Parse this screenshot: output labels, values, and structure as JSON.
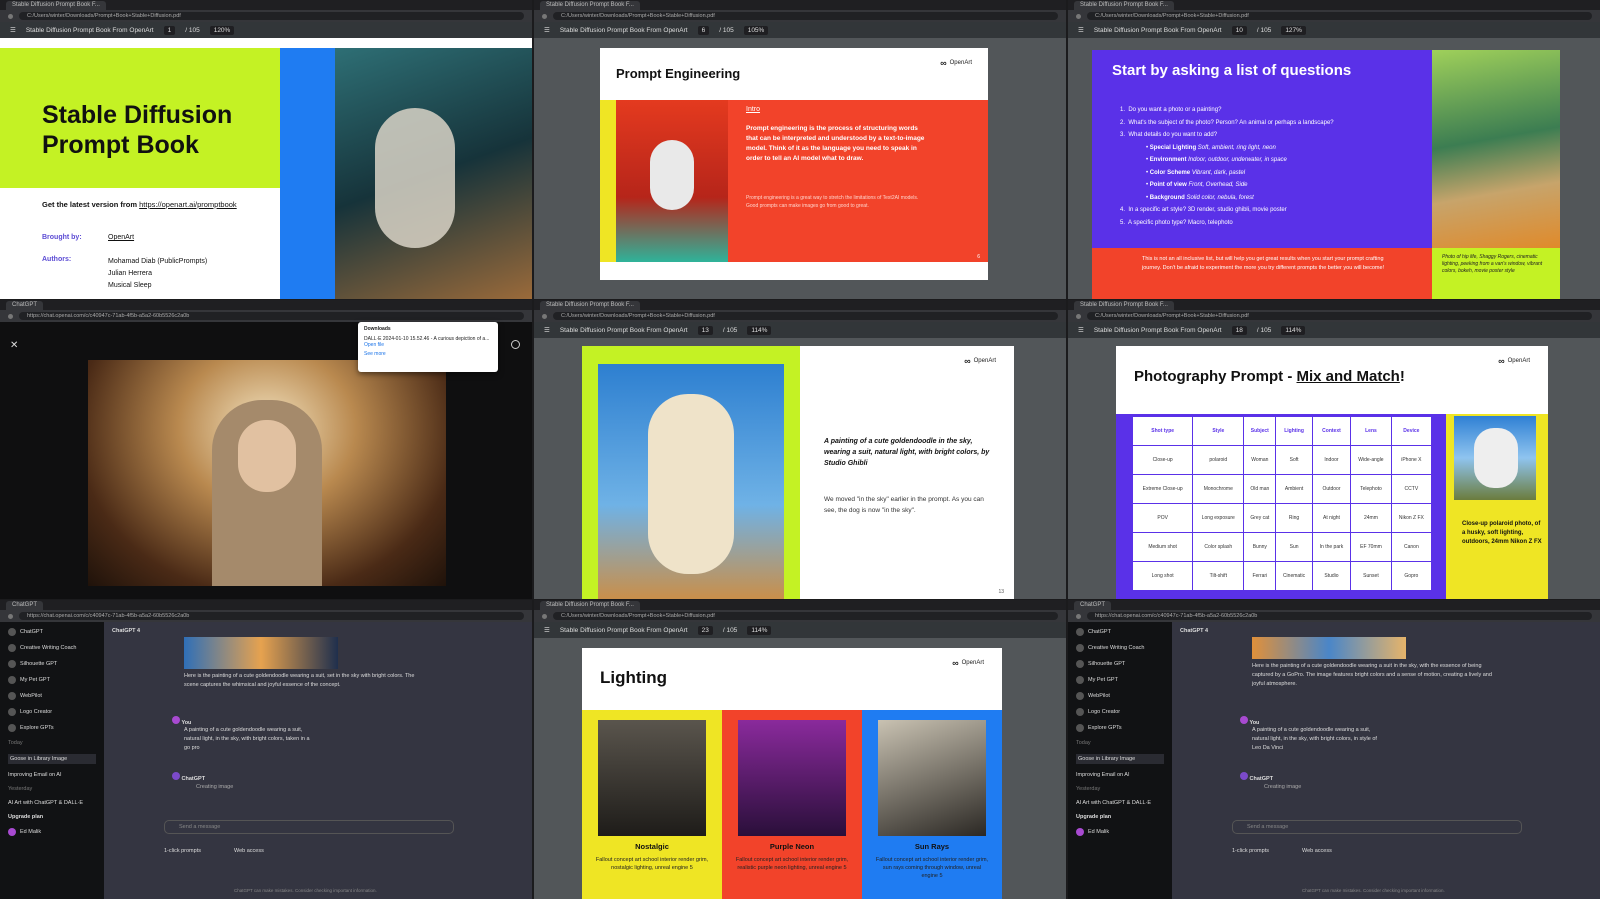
{
  "browser": {
    "pdf_tab": "Stable Diffusion Prompt Book F...",
    "chat_tab": "ChatGPT",
    "pdf_url": "C:/Users/winter/Downloads/Prompt+Book+Stable+Diffusion.pdf",
    "chat_url": "https://chat.openai.com/c/c40947c-71ab-4f5b-a5a2-60b5526c2a0b",
    "pdf_title": "Stable Diffusion Prompt Book From OpenArt"
  },
  "panel1": {
    "page": "1",
    "total": "/ 105",
    "zoom": "120%",
    "title": "Stable Diffusion Prompt Book",
    "latest_label": "Get the latest version from",
    "latest_link": "https://openart.ai/promptbook",
    "brought_label": "Brought by:",
    "brought_value": "OpenArt",
    "authors_label": "Authors:",
    "author1": "Mohamad Diab (PublicPrompts)",
    "author2": "Julian Herrera",
    "author3": "Musical Sleep"
  },
  "panel2": {
    "page": "6",
    "total": "/ 105",
    "zoom": "105%",
    "title": "Prompt Engineering",
    "logo": "OpenArt",
    "intro": "Intro",
    "body": "Prompt engineering is the process of structuring words that can be interpreted and understood by a text-to-image model. Think of it as the language you need to speak in order to tell an AI model what to draw.",
    "small": "Prompt engineering is a great way to stretch the limitations of Text2AI models. Good prompts can make images go from good to great.",
    "pagenum": "6"
  },
  "panel3": {
    "page": "10",
    "total": "/ 105",
    "zoom": "127%",
    "title": "Start by asking a list of questions",
    "q1": "Do you want a photo or a painting?",
    "q2": "What's the subject of the photo? Person? An animal or perhaps a landscape?",
    "q3": "What details do you want to add?",
    "details": [
      {
        "k": "Special Lighting",
        "v": "Soft, ambient, ring light, neon"
      },
      {
        "k": "Environment",
        "v": "Indoor, outdoor, underwater, in space"
      },
      {
        "k": "Color Scheme",
        "v": "Vibrant, dark, pastel"
      },
      {
        "k": "Point of view",
        "v": "Front, Overhead, Side"
      },
      {
        "k": "Background",
        "v": "Solid color, nebula, forest"
      }
    ],
    "q4": "In a specific art style? 3D render, studio ghibli, movie poster",
    "q5": "A specific photo type? Macro, telephoto",
    "footer": "This is not an all inclusive list, but will help you get great results when you start your prompt crafting journey. Don't be afraid to experiment the more you try different prompts the better you will become!",
    "caption": "Photo of hip life, Shaggy Rogers, cinematic lighting, peeking from a van's window, vibrant colors, bokeh, movie poster style"
  },
  "panel4": {
    "downloads_title": "Downloads",
    "file": "DALL·E 2024-01-10 15.52.46 - A curious depiction of a...",
    "open_file": "Open file",
    "see_more": "See more"
  },
  "panel5": {
    "page": "13",
    "total": "/ 105",
    "zoom": "114%",
    "logo": "OpenArt",
    "prompt": "A painting of a cute goldendoodle in the sky, wearing a suit, natural light, with bright colors, by Studio Ghibli",
    "note": "We moved \"in the sky\" earlier in the prompt. As you can see, the dog is now \"in the sky\".",
    "pagenum": "13"
  },
  "panel6": {
    "page": "18",
    "total": "/ 105",
    "zoom": "114%",
    "logo": "OpenArt",
    "title_a": "Photography Prompt - ",
    "title_b": "Mix and Match",
    "title_c": "!",
    "headers": [
      "Shot type",
      "Style",
      "Subject",
      "Lighting",
      "Context",
      "Lens",
      "Device"
    ],
    "rows": [
      [
        "Close-up",
        "polaroid",
        "Woman",
        "Soft",
        "Indoor",
        "Wide-angle",
        "iPhone X"
      ],
      [
        "Extreme Close-up",
        "Monochrome",
        "Old man",
        "Ambient",
        "Outdoor",
        "Telephoto",
        "CCTV"
      ],
      [
        "POV",
        "Long exposure",
        "Grey cat",
        "Ring",
        "At night",
        "24mm",
        "Nikon Z FX"
      ],
      [
        "Medium shot",
        "Color splash",
        "Bunny",
        "Sun",
        "In the park",
        "EF 70mm",
        "Canon"
      ],
      [
        "Long shot",
        "Tilt-shift",
        "Ferrari",
        "Cinematic",
        "Studio",
        "Sunset",
        "Gopro"
      ]
    ],
    "caption": "Close-up polaroid photo, of a husky, soft lighting, outdoors, 24mm Nikon Z FX"
  },
  "chat": {
    "sidebar": [
      "ChatGPT",
      "Creative Writing Coach",
      "Silhouette GPT",
      "My Pet GPT",
      "WebPilot",
      "Logo Creator",
      "Explore GPTs"
    ],
    "today": "Today",
    "conv1": "Goose in Library Image",
    "conv2": "Improving Email on AI",
    "yesterday": "Yesterday",
    "conv3": "AI Art with ChatGPT & DALL·E",
    "upgrade": "Upgrade plan",
    "upgrade_sub": "Collaborate on a Team plan",
    "user": "Ed Malik",
    "model": "ChatGPT 4",
    "you": "You",
    "bot": "ChatGPT",
    "creating": "Creating image",
    "placeholder": "Send a message",
    "toggle1": "1-click prompts",
    "toggle2": "Web access",
    "disclaimer": "ChatGPT can make mistakes. Consider checking important information."
  },
  "panel7": {
    "reply": "Here is the painting of a cute goldendoodle wearing a suit, set in the sky with bright colors. The scene captures the whimsical and joyful essence of the concept.",
    "prompt": "A painting of a cute goldendoodle wearing a suit, natural light, in the sky, with bright colors, taken in a go pro"
  },
  "panel8": {
    "page": "23",
    "total": "/ 105",
    "zoom": "114%",
    "logo": "OpenArt",
    "title": "Lighting",
    "items": [
      {
        "name": "Nostalgic",
        "desc": "Fallout concept art school interior render grim, nostalgic lighting, unreal engine 5"
      },
      {
        "name": "Purple Neon",
        "desc": "Fallout concept art school interior render grim, realistic purple neon lighting, unreal engine 5"
      },
      {
        "name": "Sun Rays",
        "desc": "Fallout concept art school interior render grim, sun rays coming through window, unreal engine 5"
      }
    ],
    "pagenum": "23"
  },
  "panel9": {
    "reply": "Here is the painting of a cute goldendoodle wearing a suit in the sky, with the essence of being captured by a GoPro. The image features bright colors and a sense of motion, creating a lively and joyful atmosphere.",
    "prompt": "A painting of a cute goldendoodle wearing a suit, natural light, in the sky, with bright colors, in style of Leo Da Vinci"
  }
}
